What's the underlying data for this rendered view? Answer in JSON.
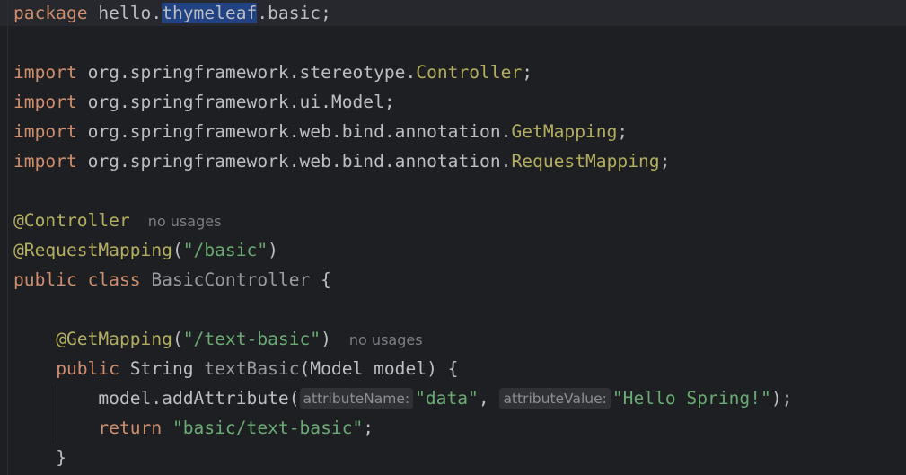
{
  "code": {
    "package_kw": "package",
    "package_prefix": "hello.",
    "package_selected": "thymeleaf",
    "package_suffix": ".basic;",
    "import_kw": "import",
    "import1_path": "org.springframework.stereotype.",
    "import1_class": "Controller",
    "import2_path": "org.springframework.ui.Model;",
    "import3_path": "org.springframework.web.bind.annotation.",
    "import3_class": "GetMapping",
    "import4_path": "org.springframework.web.bind.annotation.",
    "import4_class": "RequestMapping",
    "semicolon": ";",
    "ann_controller": "@Controller",
    "ann_request_mapping": "@RequestMapping",
    "request_mapping_open": "(",
    "request_mapping_value": "\"/basic\"",
    "request_mapping_close": ")",
    "public_kw": "public",
    "class_kw": "class",
    "class_name": "BasicController",
    "open_brace": "{",
    "ann_get_mapping": "@GetMapping",
    "get_mapping_value": "\"/text-basic\"",
    "string_type": "String",
    "method_name": "textBasic",
    "method_params": "(Model model) {",
    "model_call": "model.addAttribute(",
    "param_hint_name": "attributeName:",
    "arg_data": "\"data\"",
    "comma": ", ",
    "param_hint_value": "attributeValue:",
    "arg_value": "\"Hello Spring!\"",
    "call_close": ");",
    "return_kw": "return",
    "return_value": "\"basic/text-basic\"",
    "close_brace": "}"
  },
  "hints": {
    "no_usages": "no usages"
  },
  "colors": {
    "background": "#1e1f22",
    "keyword": "#cf8e6d",
    "annotation": "#b3ae60",
    "string": "#6aab73",
    "text": "#bcbec4",
    "selection": "#214283"
  }
}
